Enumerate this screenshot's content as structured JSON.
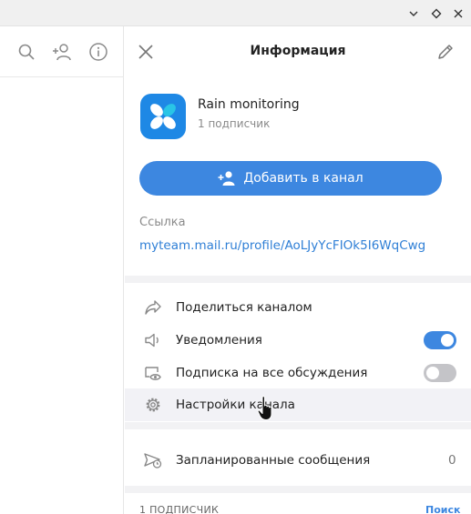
{
  "header": {
    "title": "Информация"
  },
  "channel": {
    "name": "Rain monitoring",
    "subscribers": "1 подписчик"
  },
  "add_button": {
    "label": "Добавить в канал"
  },
  "link": {
    "label": "Ссылка",
    "url": "myteam.mail.ru/profile/AoLJyYcFIOk5I6WqCwg"
  },
  "menu": {
    "share": "Поделиться каналом",
    "notifications": "Уведомления",
    "notifications_on": true,
    "subscribe_all": "Подписка на все обсуждения",
    "subscribe_all_on": false,
    "settings": "Настройки канала",
    "scheduled": "Запланированные сообщения",
    "scheduled_count": "0"
  },
  "members": {
    "title": "1 ПОДПИСЧИК",
    "search": "Поиск"
  },
  "colors": {
    "accent": "#3d87e0",
    "link": "#2f7fd6",
    "avatar": "#1e88e5",
    "avatar_accent": "#29c5e6"
  }
}
